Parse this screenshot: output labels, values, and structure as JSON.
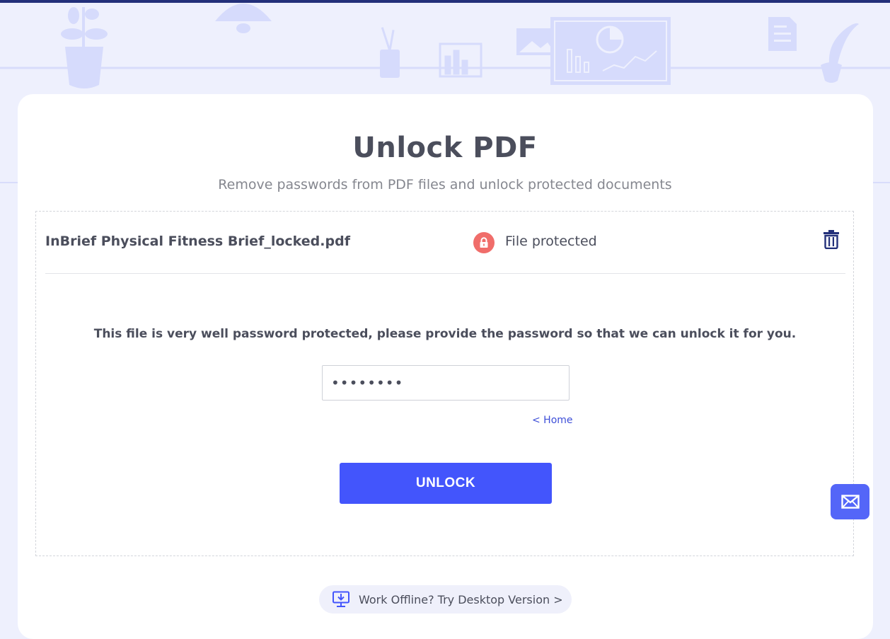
{
  "page": {
    "title": "Unlock PDF",
    "subtitle": "Remove passwords from PDF files and unlock protected documents"
  },
  "file": {
    "name": "InBrief Physical Fitness Brief_locked.pdf",
    "status": "File protected",
    "status_icon": "lock-icon",
    "delete_icon": "trash-icon"
  },
  "prompt": {
    "message": "This file is very well password protected, please provide the password so that we can unlock it for you."
  },
  "password": {
    "value": "••••••••"
  },
  "links": {
    "home": "< Home"
  },
  "actions": {
    "unlock_label": "UNLOCK"
  },
  "desktop": {
    "label": "Work Offline? Try Desktop Version >",
    "icon": "desktop-download-icon"
  },
  "contact": {
    "icon": "mail-icon"
  },
  "colors": {
    "accent": "#4355fc",
    "header_bar": "#23307a",
    "lock_badge": "#f06d6a",
    "background": "#eef0fd"
  }
}
